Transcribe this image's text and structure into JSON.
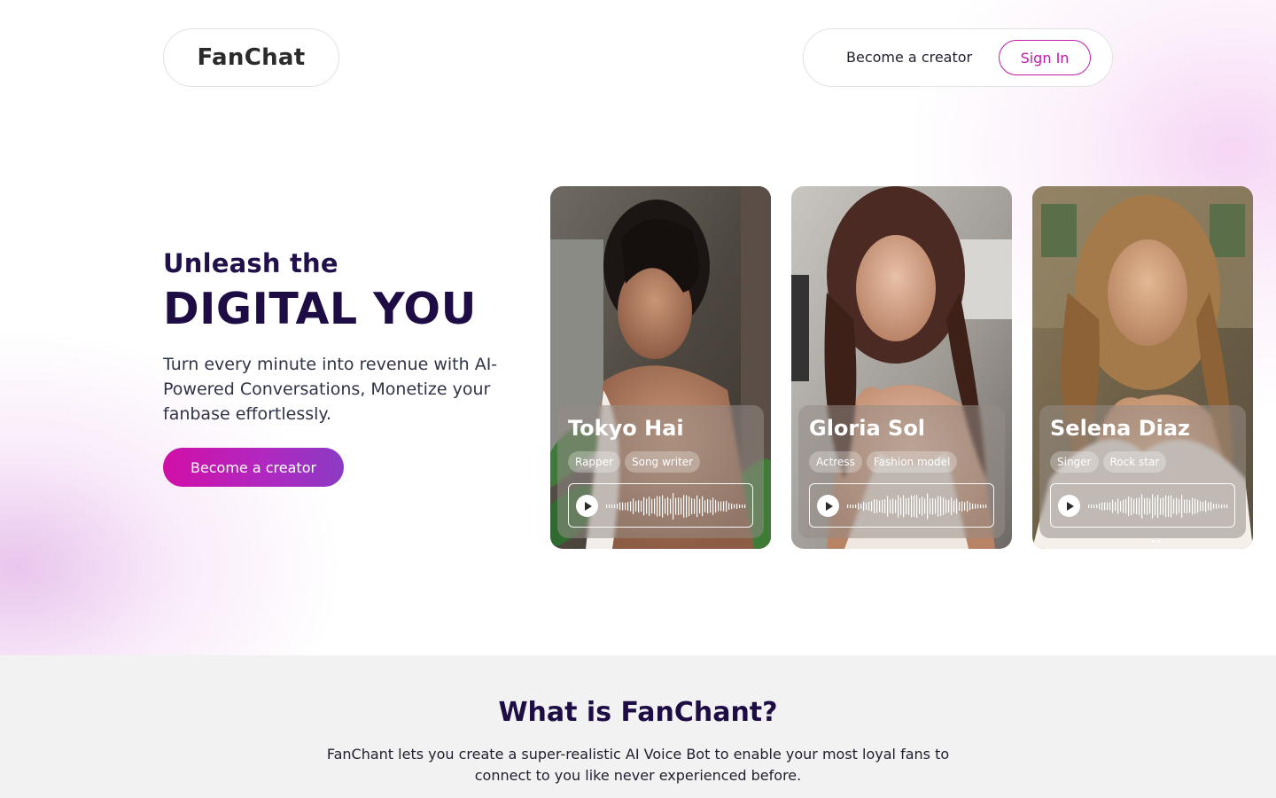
{
  "header": {
    "logo": "FanChat",
    "nav_creator": "Become a creator",
    "sign_in": "Sign In"
  },
  "hero": {
    "subtitle": "Unleash the",
    "title": "DIGITAL YOU",
    "description": "Turn every minute into revenue with AI-Powered Conversations, Monetize your fanbase effortlessly.",
    "cta": "Become a creator"
  },
  "cards": [
    {
      "name": "Tokyo Hai",
      "tags": [
        "Rapper",
        "Song writer"
      ],
      "play_icon": "play-icon"
    },
    {
      "name": "Gloria Sol",
      "tags": [
        "Actress",
        "Fashion model"
      ],
      "play_icon": "play-icon"
    },
    {
      "name": "Selena Diaz",
      "tags": [
        "Singer",
        "Rock star"
      ],
      "play_icon": "play-icon"
    }
  ],
  "about": {
    "title": "What is FanChant?",
    "description": "FanChant lets you create a super-realistic AI Voice Bot to enable your most loyal fans to connect to you like never experienced before."
  },
  "colors": {
    "brand": "#c21ba8",
    "heading": "#1e0c45",
    "section_bg": "#f2f2f2"
  }
}
